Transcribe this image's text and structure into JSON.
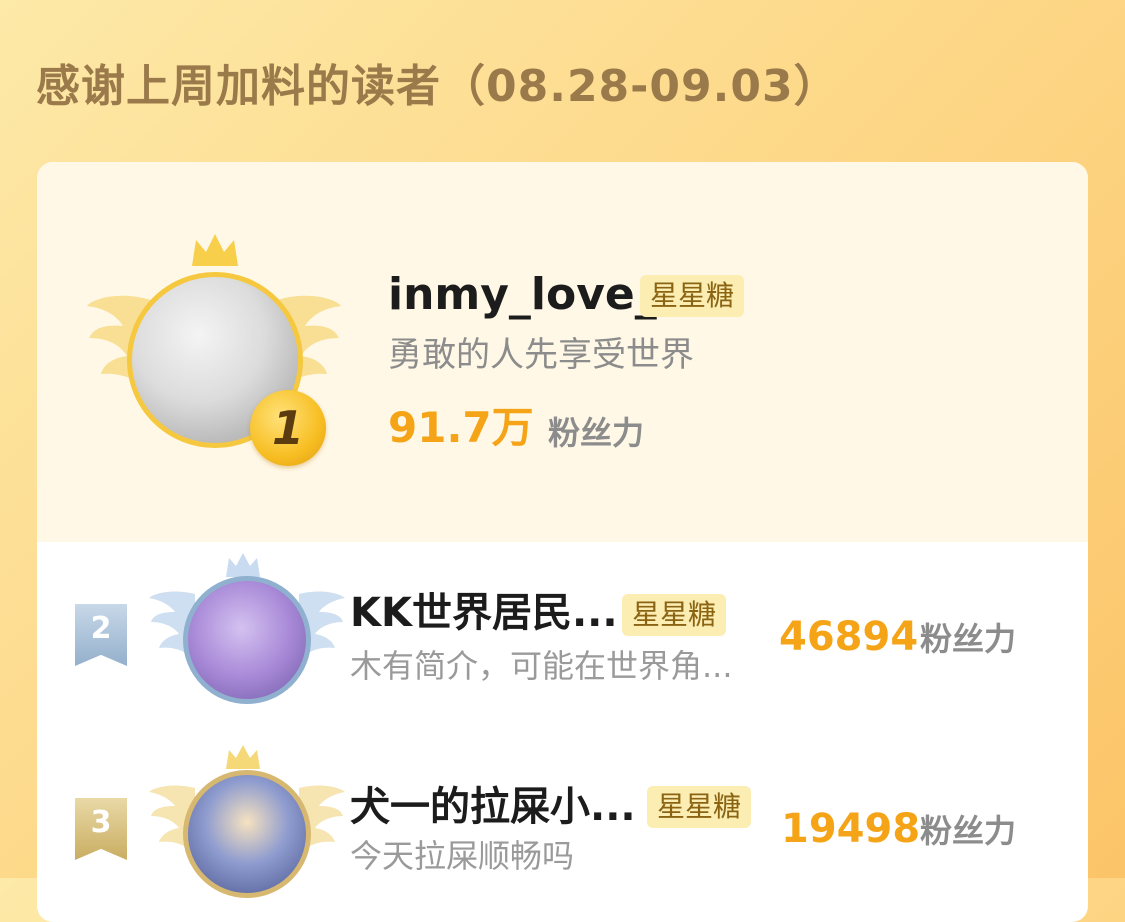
{
  "header": {
    "title": "感谢上周加料的读者（08.28-09.03）"
  },
  "ranking": [
    {
      "rank": "1",
      "name": "inmy_love_",
      "badge": "星星糖",
      "signature": "勇敢的人先享受世界",
      "fans_value": "91.7万",
      "fans_label": "粉丝力"
    },
    {
      "rank": "2",
      "name": "KK世界居民...",
      "badge": "星星糖",
      "signature": "木有简介，可能在世界角...",
      "fans_value": "46894",
      "fans_label": "粉丝力"
    },
    {
      "rank": "3",
      "name": "犬一的拉屎小...",
      "badge": "星星糖",
      "signature": "今天拉屎顺畅吗",
      "fans_value": "19498",
      "fans_label": "粉丝力"
    }
  ],
  "colors": {
    "accent": "#f5a418",
    "gold": "#f5c840",
    "silver": "#8fb0cf",
    "bronze": "#d7b870"
  },
  "icons": [
    "crown-icon",
    "wings-icon",
    "rank-medal-icon",
    "rank-flag-icon"
  ]
}
